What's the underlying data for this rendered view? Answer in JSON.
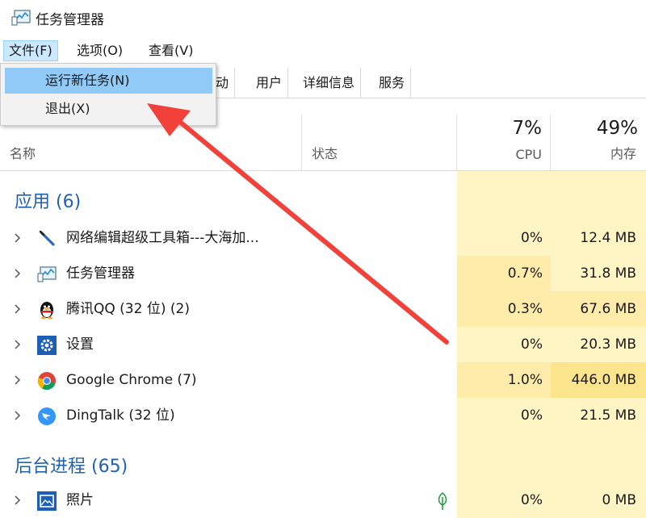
{
  "window": {
    "title": "任务管理器"
  },
  "menu": [
    "文件(F)",
    "选项(O)",
    "查看(V)"
  ],
  "file_menu": [
    "运行新任务(N)",
    "退出(X)"
  ],
  "tabs": [
    "启动",
    "用户",
    "详细信息",
    "服务"
  ],
  "columns": {
    "name": "名称",
    "status": "状态",
    "cpu": "CPU",
    "memory": "内存"
  },
  "usage": {
    "cpu": "7%",
    "memory": "49%"
  },
  "groups": {
    "apps": {
      "title": "应用 (6)",
      "rows": [
        {
          "name": "网络编辑超级工具箱---大海加...",
          "cpu": "0%",
          "memory": "12.4 MB",
          "icon": "pen-tool-icon"
        },
        {
          "name": "任务管理器",
          "cpu": "0.7%",
          "memory": "31.8 MB",
          "icon": "task-manager-icon"
        },
        {
          "name": "腾讯QQ (32 位) (2)",
          "cpu": "0.3%",
          "memory": "67.6 MB",
          "icon": "qq-penguin-icon"
        },
        {
          "name": "设置",
          "cpu": "0%",
          "memory": "20.3 MB",
          "icon": "settings-gear-icon"
        },
        {
          "name": "Google Chrome (7)",
          "cpu": "1.0%",
          "memory": "446.0 MB",
          "icon": "chrome-icon"
        },
        {
          "name": "DingTalk (32 位)",
          "cpu": "0%",
          "memory": "21.5 MB",
          "icon": "dingtalk-icon"
        }
      ]
    },
    "background": {
      "title": "后台进程 (65)",
      "rows": [
        {
          "name": "照片",
          "cpu": "0%",
          "memory": "0 MB",
          "icon": "photos-icon",
          "status_icon": "suspended-leaf-icon"
        }
      ]
    }
  },
  "colors": {
    "accent_blue": "#2062b0",
    "menu_highlight": "#91c9f7",
    "heat_light": "#fff4c4",
    "heat_mid": "#ffecab",
    "heat_strong": "#fce48c",
    "annotation_arrow": "#f0423a"
  }
}
